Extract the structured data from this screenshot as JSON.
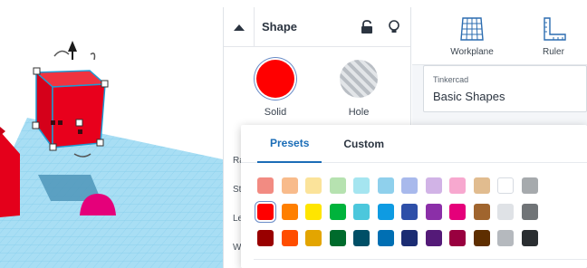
{
  "inspector": {
    "title": "Shape",
    "icons": [
      "collapse-arrow-icon",
      "lock-icon",
      "lightbulb-icon"
    ],
    "materials": [
      {
        "label": "Solid",
        "color": "#ff0000"
      },
      {
        "label": "Hole",
        "pattern": "striped-gray"
      }
    ],
    "property_labels": [
      "Ra",
      "St",
      "Le",
      "Wi"
    ]
  },
  "library": {
    "tools": [
      {
        "label": "Workplane",
        "icon": "workplane-grid-icon"
      },
      {
        "label": "Ruler",
        "icon": "ruler-icon"
      }
    ],
    "selector": {
      "small": "Tinkercad",
      "main": "Basic Shapes"
    }
  },
  "color_picker": {
    "tabs": [
      "Presets",
      "Custom"
    ],
    "active_tab": "Presets",
    "selected_color": "#ff0000",
    "swatches": [
      [
        "#f28b82",
        "#f8bb8b",
        "#fbe39a",
        "#b6e2b0",
        "#a5e5f0",
        "#8fd0ec",
        "#a8b9ec",
        "#d1b3e6",
        "#f7a8cf",
        "#e1bc8f",
        "#ffffff",
        "#a6aaad"
      ],
      [
        "#ff0000",
        "#ff7f00",
        "#ffe500",
        "#00b33c",
        "#4cc7dc",
        "#0e9be2",
        "#2e4fa8",
        "#8b2fa8",
        "#e5007a",
        "#a0652e",
        "#dfe2e6",
        "#707477"
      ],
      [
        "#990000",
        "#ff4d00",
        "#e3a500",
        "#006b2c",
        "#004f66",
        "#006fb3",
        "#1b2c73",
        "#541a78",
        "#99003f",
        "#5e2e00",
        "#b5b9be",
        "#2a2e31"
      ]
    ]
  },
  "theme": {
    "accent": "#1b6db7",
    "workplane": "#9fdcf5",
    "shape": "#e8001c"
  }
}
